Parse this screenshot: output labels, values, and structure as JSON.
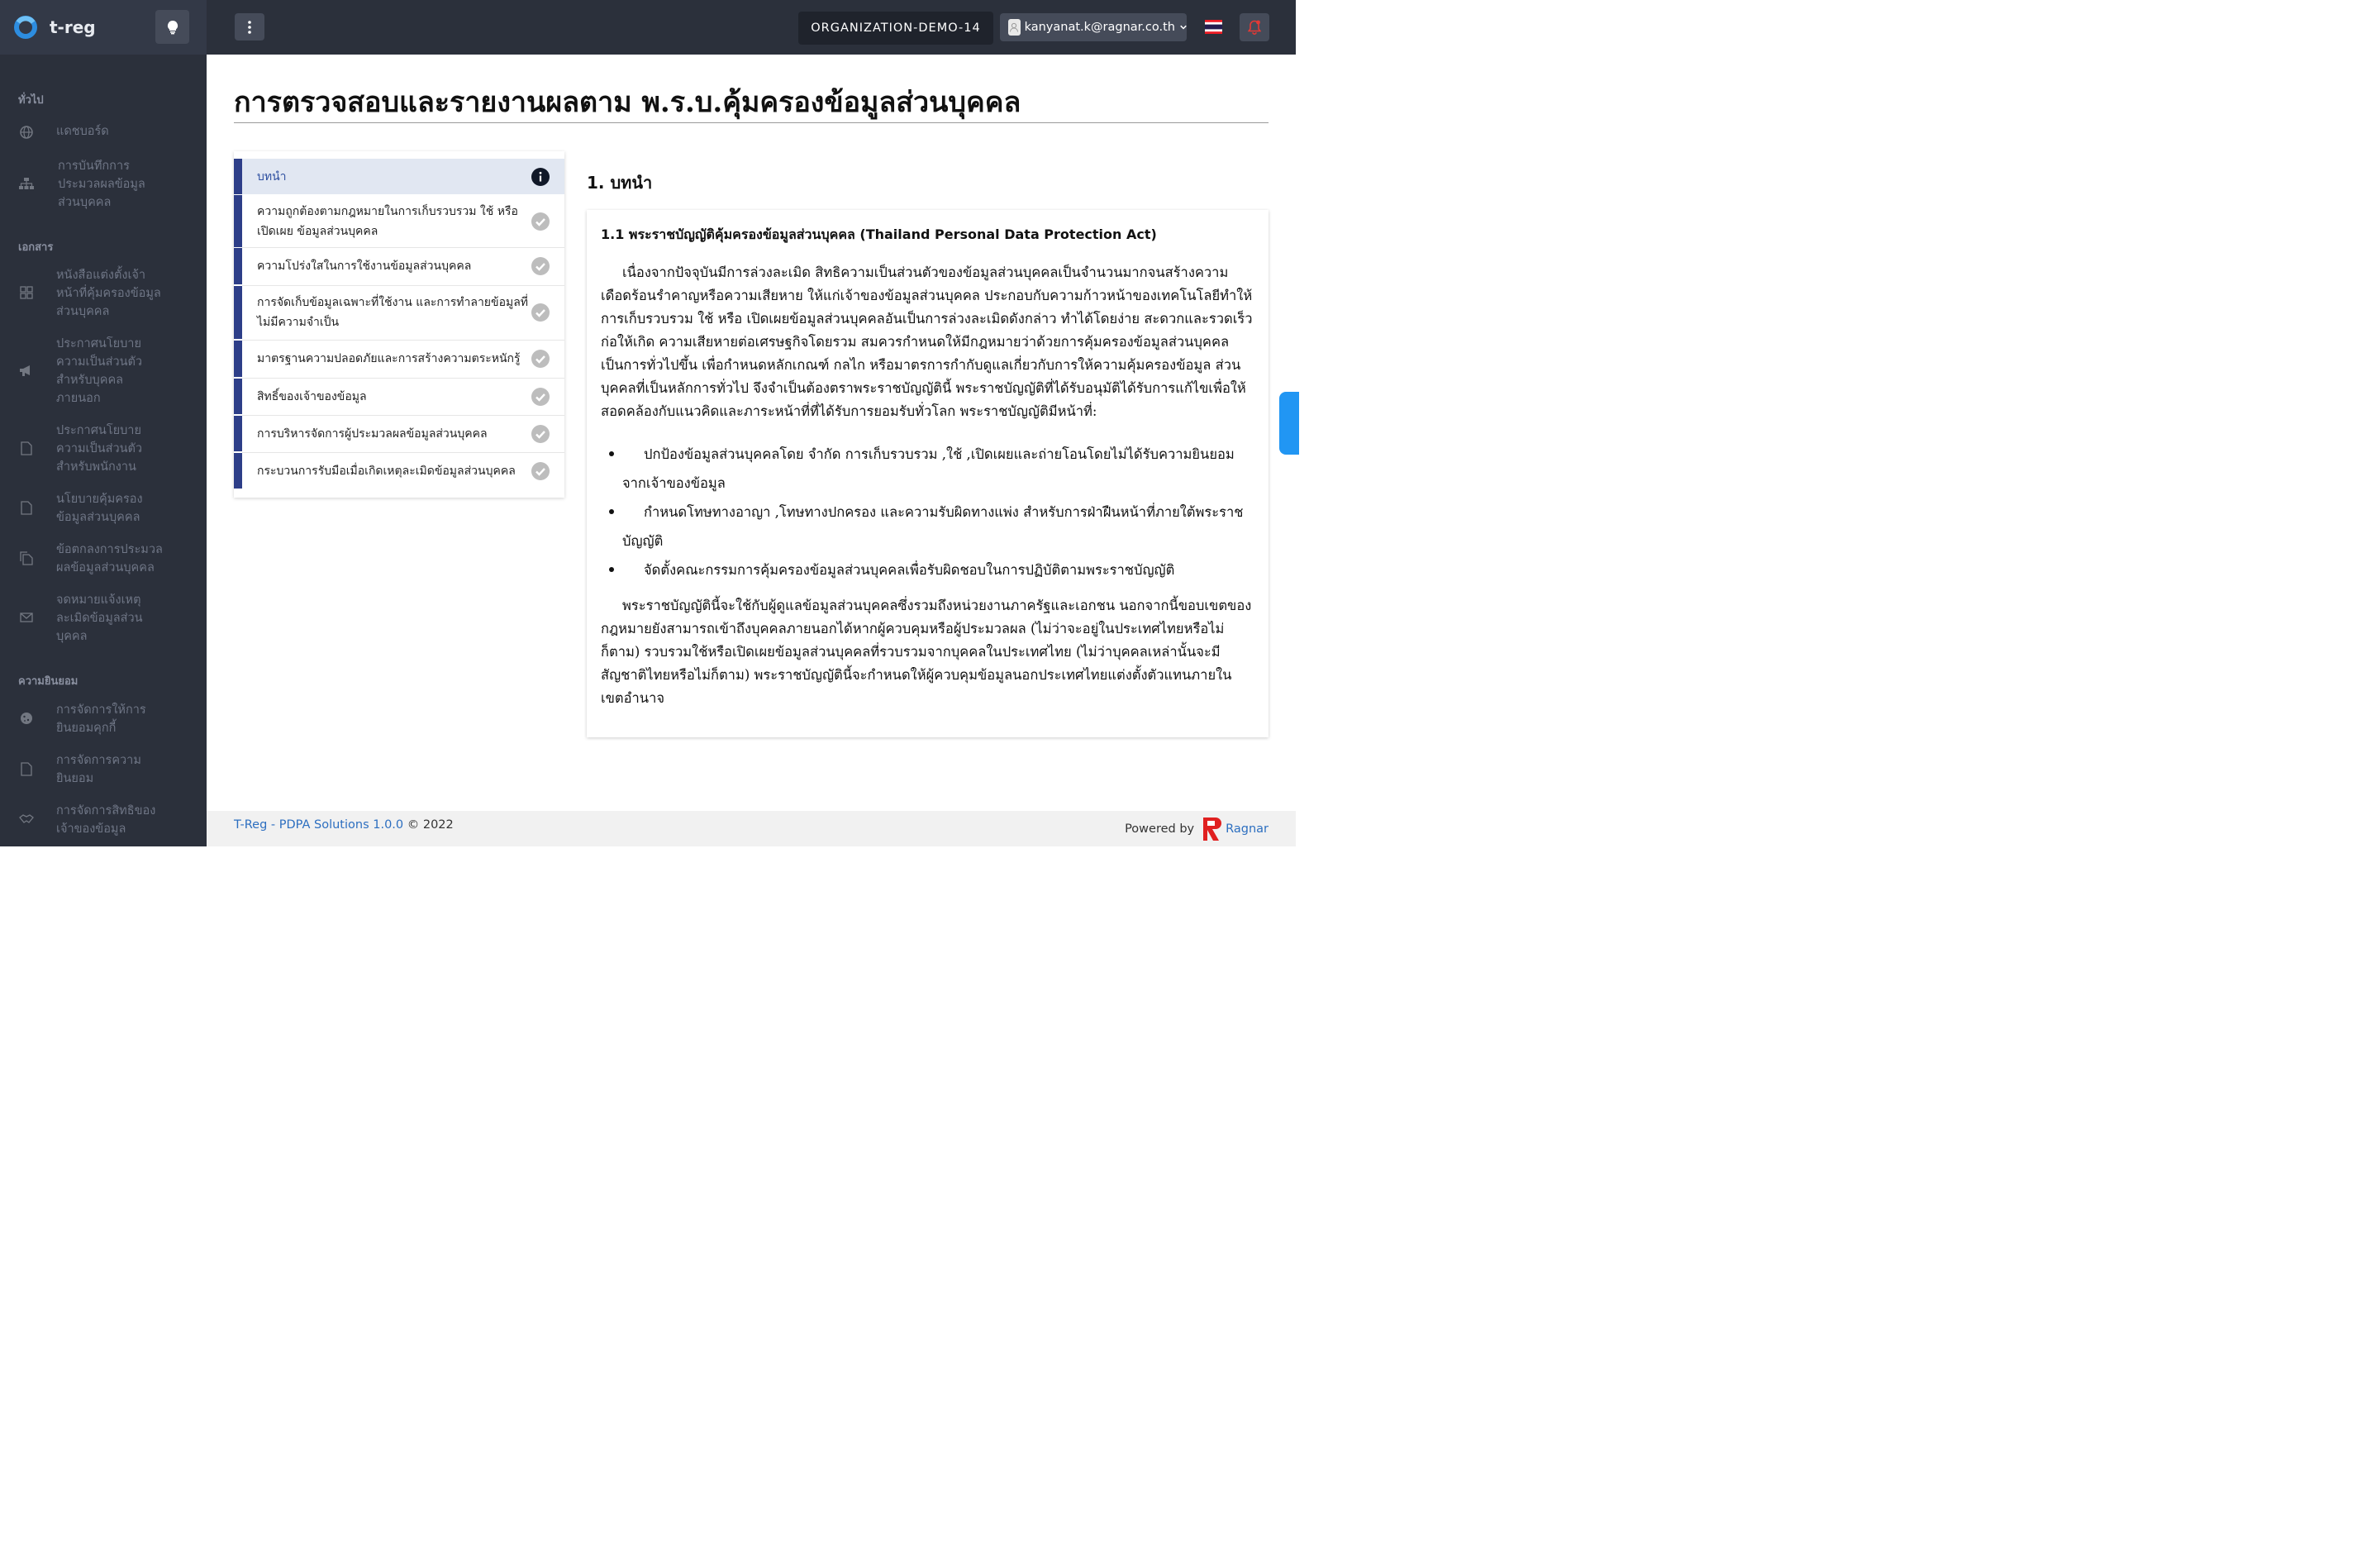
{
  "brand": {
    "name": "t-reg"
  },
  "sidebar": {
    "sections": [
      {
        "title": "ทั่วไป",
        "items": [
          {
            "label": "แดชบอร์ด",
            "icon": "globe-icon"
          },
          {
            "label": "การบันทึกการประมวลผลข้อมูลส่วนบุคคล",
            "icon": "sitemap-icon"
          }
        ]
      },
      {
        "title": "เอกสาร",
        "items": [
          {
            "label": "หนังสือแต่งตั้งเจ้าหน้าที่คุ้มครองข้อมูลส่วนบุคคล",
            "icon": "grid-icon"
          },
          {
            "label": "ประกาศนโยบายความเป็นส่วนตัวสำหรับบุคคลภายนอก",
            "icon": "megaphone-icon"
          },
          {
            "label": "ประกาศนโยบายความเป็นส่วนตัวสำหรับพนักงาน",
            "icon": "document-icon"
          },
          {
            "label": "นโยบายคุ้มครองข้อมูลส่วนบุคคล",
            "icon": "document-icon"
          },
          {
            "label": "ข้อตกลงการประมวลผลข้อมูลส่วนบุคคล",
            "icon": "copy-icon"
          },
          {
            "label": "จดหมายแจ้งเหตุละเมิดข้อมูลส่วนบุคคล",
            "icon": "envelope-icon"
          }
        ]
      },
      {
        "title": "ความยินยอม",
        "items": [
          {
            "label": "การจัดการให้การยินยอมคุกกี้",
            "icon": "cookie-icon"
          },
          {
            "label": "การจัดการความยินยอม",
            "icon": "document-icon"
          },
          {
            "label": "การจัดการสิทธิของเจ้าของข้อมูล",
            "icon": "handshake-icon"
          }
        ]
      }
    ]
  },
  "topbar": {
    "organization": "ORGANIZATION-DEMO-14",
    "user_email": "kanyanat.k@ragnar.co.th",
    "language": "Thai flag"
  },
  "page": {
    "title": "การตรวจสอบและรายงานผลตาม พ.ร.บ.คุ้มครองข้อมูลส่วนบุคคล"
  },
  "toc": [
    {
      "label": "บทนำ",
      "status": "current"
    },
    {
      "label": "ความถูกต้องตามกฎหมายในการเก็บรวบรวม ใช้ หรือเปิดเผย ข้อมูลส่วนบุคคล",
      "status": "done"
    },
    {
      "label": "ความโปร่งใสในการใช้งานข้อมูลส่วนบุคคล",
      "status": "done"
    },
    {
      "label": "การจัดเก็บข้อมูลเฉพาะที่ใช้งาน และการทำลายข้อมูลที่ไม่มีความจำเป็น",
      "status": "done"
    },
    {
      "label": "มาตรฐานความปลอดภัยและการสร้างความตระหนักรู้",
      "status": "done"
    },
    {
      "label": "สิทธิ์ของเจ้าของข้อมูล",
      "status": "done"
    },
    {
      "label": "การบริหารจัดการผู้ประมวลผลข้อมูลส่วนบุคคล",
      "status": "done"
    },
    {
      "label": "กระบวนการรับมือเมื่อเกิดเหตุละเมิดข้อมูลส่วนบุคคล",
      "status": "done"
    }
  ],
  "content": {
    "section_heading": "1. บทนำ",
    "subheading": "1.1 พระราชบัญญัติคุ้มครองข้อมูลส่วนบุคคล (Thailand Personal Data Protection Act)",
    "paragraph1": "เนื่องจากปัจจุบันมีการล่วงละเมิด สิทธิความเป็นส่วนตัวของข้อมูลส่วนบุคคลเป็นจำนวนมากจนสร้างความเดือดร้อนรำคาญหรือความเสียหาย ให้แก่เจ้าของข้อมูลส่วนบุคคล ประกอบกับความก้าวหน้าของเทคโนโลยีทำให้การเก็บรวบรวม ใช้ หรือ เปิดเผยข้อมูลส่วนบุคคลอันเป็นการล่วงละเมิดดังกล่าว ทำได้โดยง่าย สะดวกและรวดเร็ว ก่อให้เกิด ความเสียหายต่อเศรษฐกิจโดยรวม สมควรกำหนดให้มีกฎหมายว่าด้วยการคุ้มครองข้อมูลส่วนบุคคล เป็นการทั่วไปขึ้น เพื่อกำหนดหลักเกณฑ์ กลไก หรือมาตรการกำกับดูแลเกี่ยวกับการให้ความคุ้มครองข้อมูล ส่วนบุคคลที่เป็นหลักการทั่วไป จึงจำเป็นต้องตราพระราชบัญญัตินี้ พระราชบัญญัติที่ได้รับอนุมัติได้รับการแก้ไขเพื่อให้สอดคล้องกับแนวคิดและภาระหน้าที่ที่ได้รับการยอมรับทั่วโลก พระราชบัญญัติมีหน้าที่:",
    "bullets": [
      "ปกป้องข้อมูลส่วนบุคคลโดย จำกัด การเก็บรวบรวม ,ใช้ ,เปิดเผยและถ่ายโอนโดยไม่ได้รับความยินยอมจากเจ้าของข้อมูล",
      "กำหนดโทษทางอาญา ,โทษทางปกครอง และความรับผิดทางแพ่ง สำหรับการฝ่าฝืนหน้าที่ภายใต้พระราชบัญญัติ",
      "จัดตั้งคณะกรรมการคุ้มครองข้อมูลส่วนบุคคลเพื่อรับผิดชอบในการปฏิบัติตามพระราชบัญญัติ"
    ],
    "paragraph2": "พระราชบัญญัตินี้จะใช้กับผู้ดูแลข้อมูลส่วนบุคคลซึ่งรวมถึงหน่วยงานภาครัฐและเอกชน นอกจากนี้ขอบเขตของกฎหมายยังสามารถเข้าถึงบุคคลภายนอกได้หากผู้ควบคุมหรือผู้ประมวลผล (ไม่ว่าจะอยู่ในประเทศไทยหรือไม่ก็ตาม) รวบรวมใช้หรือเปิดเผยข้อมูลส่วนบุคคลที่รวบรวมจากบุคคลในประเทศไทย (ไม่ว่าบุคคลเหล่านั้นจะมีสัญชาติไทยหรือไม่ก็ตาม) พระราชบัญญัตินี้จะกำหนดให้ผู้ควบคุมข้อมูลนอกประเทศไทยแต่งตั้งตัวแทนภายในเขตอำนาจ"
  },
  "footer": {
    "product": "T-Reg - PDPA Solutions 1.0.0",
    "copyright": "© 2022",
    "powered_by": "Powered by",
    "company": "Ragnar"
  }
}
